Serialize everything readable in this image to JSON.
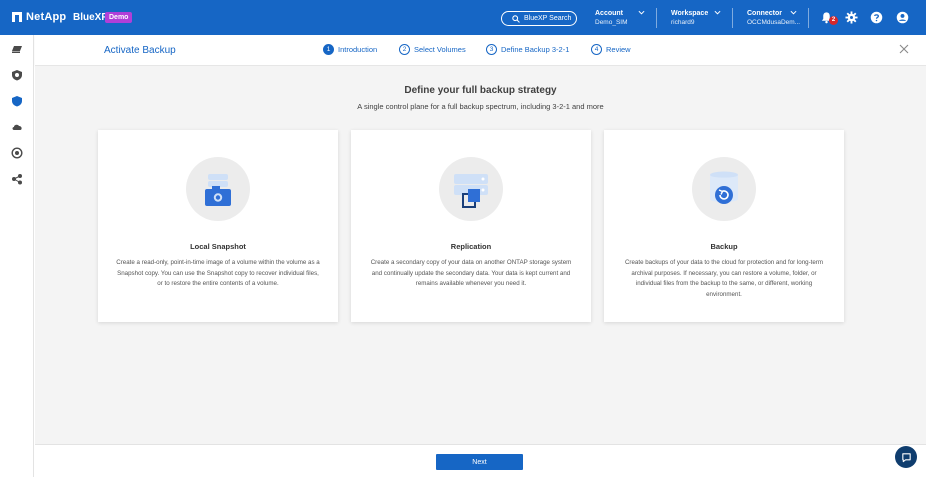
{
  "header": {
    "brand": "NetApp",
    "product": "BlueXP",
    "badge": "Demo",
    "search_label": "BlueXP Search",
    "account_label": "Account",
    "account_value": "Demo_SIM",
    "workspace_label": "Workspace",
    "workspace_value": "richard9",
    "connector_label": "Connector",
    "connector_value": "OCCMdusaDem...",
    "notification_count": "2",
    "icons": [
      "netapp-logo-icon",
      "search-icon",
      "bell-icon",
      "gear-icon",
      "help-icon",
      "user-icon"
    ]
  },
  "sidebar": {
    "icons": [
      "storage-icon",
      "protection-icon",
      "shield-icon",
      "cloud-icon",
      "governance-icon",
      "mobility-icon"
    ]
  },
  "wizard": {
    "title": "Activate Backup",
    "steps": [
      {
        "num": "1",
        "label": "Introduction",
        "active": true
      },
      {
        "num": "2",
        "label": "Select Volumes",
        "active": false
      },
      {
        "num": "3",
        "label": "Define Backup 3-2-1",
        "active": false
      },
      {
        "num": "4",
        "label": "Review",
        "active": false
      }
    ]
  },
  "main": {
    "heading": "Define your full backup strategy",
    "subheading": "A single control plane for a full backup spectrum, including 3-2-1 and more",
    "cards": [
      {
        "title": "Local Snapshot",
        "description": "Create a read-only, point-in-time image of a volume within the volume as a Snapshot copy. You can use the Snapshot copy to recover individual files, or to restore the entire contents of a volume.",
        "icon": "snapshot-icon"
      },
      {
        "title": "Replication",
        "description": "Create a secondary copy of your data on another ONTAP storage system and continually update the secondary data. Your data is kept current and remains available whenever you need it.",
        "icon": "replication-icon"
      },
      {
        "title": "Backup",
        "description": "Create backups of your data to the cloud for protection and for long-term archival purposes. If necessary, you can restore a volume, folder, or individual files from the backup to the same, or different, working environment.",
        "icon": "backup-icon"
      }
    ]
  },
  "footer": {
    "next_label": "Next"
  },
  "colors": {
    "primary": "#1666c5",
    "badge": "#b13fd8",
    "notification": "#d6272b",
    "background": "#f4f4f4"
  }
}
